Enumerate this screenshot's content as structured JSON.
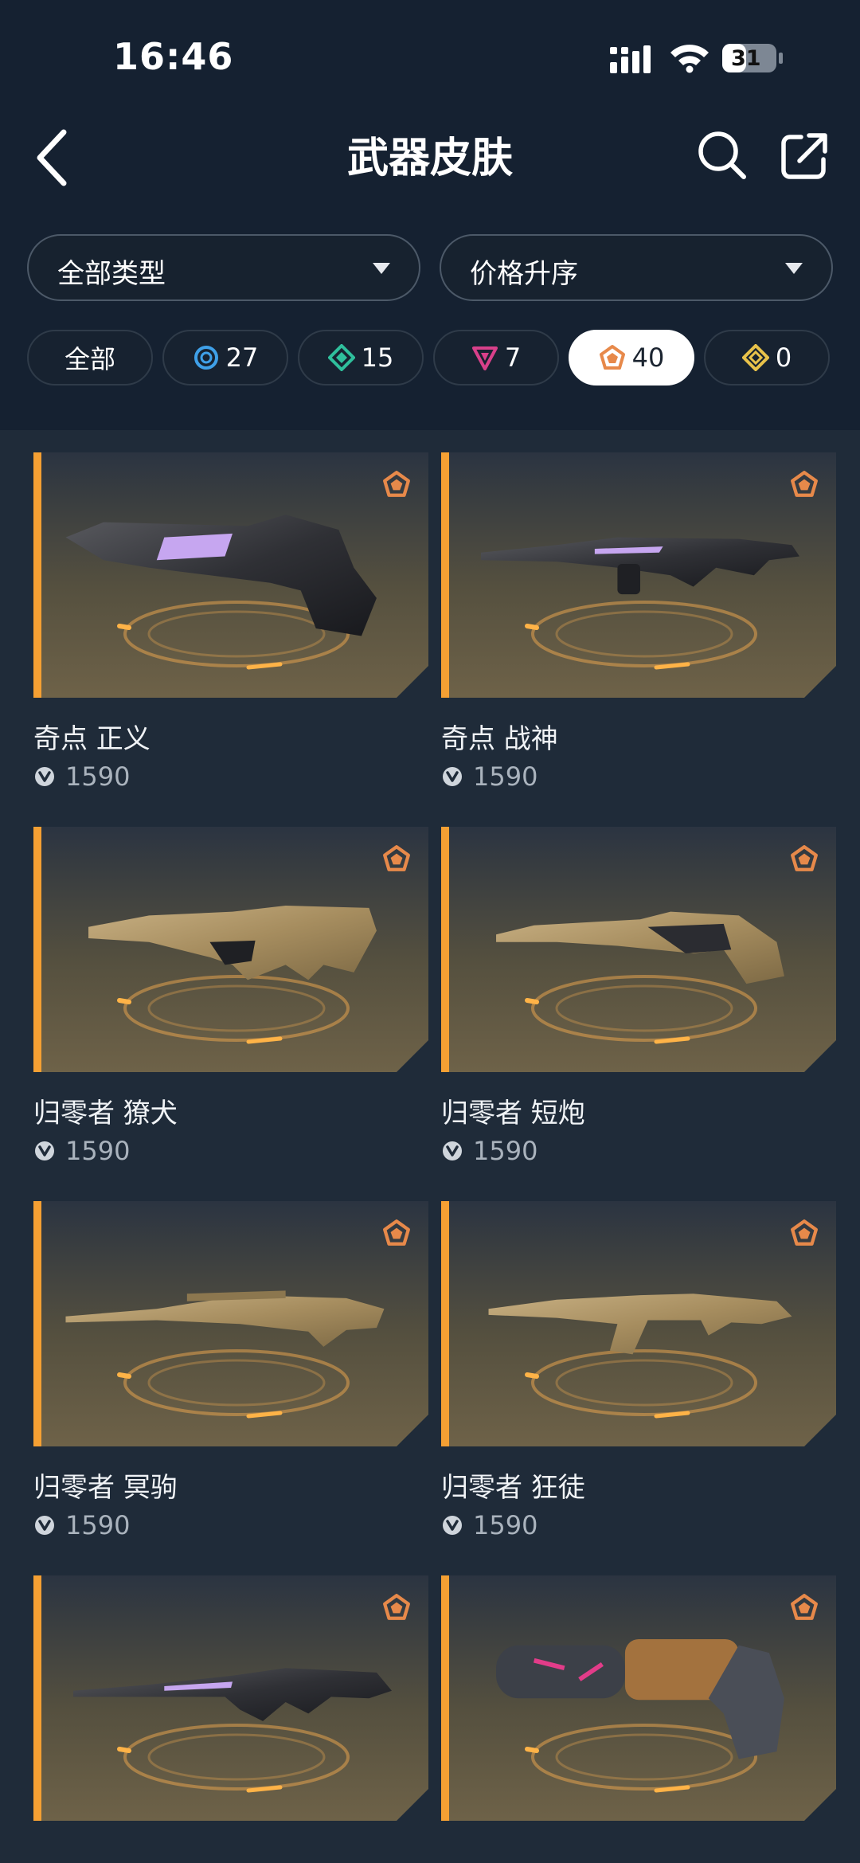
{
  "status_bar": {
    "time": "16:46",
    "battery": "31"
  },
  "header": {
    "title": "武器皮肤"
  },
  "filters": {
    "type_select": "全部类型",
    "sort_select": "价格升序"
  },
  "tiers": [
    {
      "label": "全部",
      "icon": "all",
      "active": false
    },
    {
      "label": "27",
      "icon": "select-tier-icon",
      "color": "#3fa0e8",
      "active": false
    },
    {
      "label": "15",
      "icon": "deluxe-tier-icon",
      "color": "#2fbf9c",
      "active": false
    },
    {
      "label": "7",
      "icon": "premium-tier-icon",
      "color": "#d8408a",
      "active": false
    },
    {
      "label": "40",
      "icon": "exclusive-tier-icon",
      "color": "#e7894a",
      "active": true
    },
    {
      "label": "0",
      "icon": "ultra-tier-icon",
      "color": "#e8c24a",
      "active": false
    }
  ],
  "skins": [
    {
      "name": "奇点 正义",
      "price": "1590",
      "gun": "revolver-dark"
    },
    {
      "name": "奇点 战神",
      "price": "1590",
      "gun": "rifle-dark"
    },
    {
      "name": "归零者 獠犬",
      "price": "1590",
      "gun": "smg-gold"
    },
    {
      "name": "归零者 短炮",
      "price": "1590",
      "gun": "shotgun-gold"
    },
    {
      "name": "归零者 冥驹",
      "price": "1590",
      "gun": "sniper-gold"
    },
    {
      "name": "归零者 狂徒",
      "price": "1590",
      "gun": "rifle-gold"
    },
    {
      "name": "",
      "price": "",
      "gun": "rifle-dark-2"
    },
    {
      "name": "",
      "price": "",
      "gun": "revolver-copper"
    }
  ],
  "colors": {
    "accent": "#f5a033",
    "background": "#1f2b39",
    "header_bg": "#152131"
  }
}
